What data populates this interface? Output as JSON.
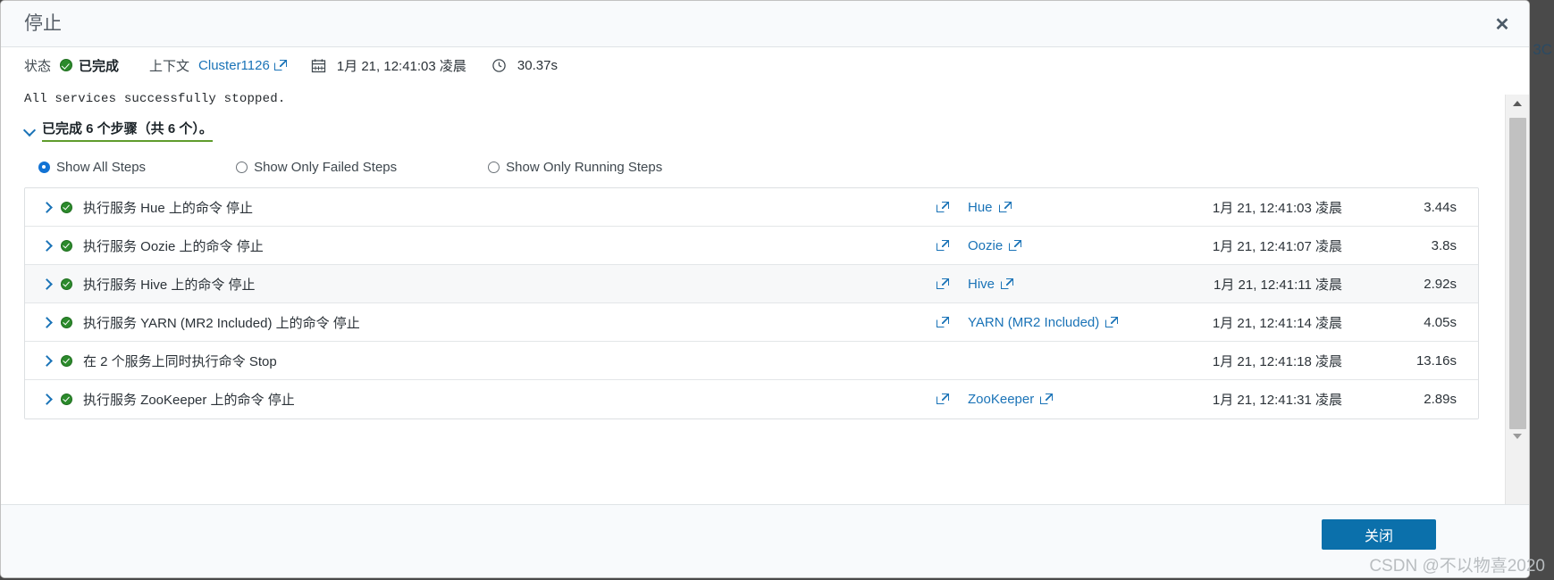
{
  "background": {
    "edge_text": "3C"
  },
  "modal": {
    "title": "停止",
    "close_x_icon": "close-icon",
    "status": {
      "status_label": "状态",
      "status_value": "已完成",
      "status_icon": "check-circle-icon",
      "context_label": "上下文",
      "context_link": "Cluster1126",
      "context_link_icon": "external-link-icon",
      "calendar_icon": "calendar-icon",
      "timestamp": "1月 21, 12:41:03 凌晨",
      "clock_icon": "clock-icon",
      "duration": "30.37s"
    },
    "log_message": "All services successfully stopped.",
    "steps_summary": {
      "chevron_icon": "chevron-down-icon",
      "text": "已完成 6 个步骤（共 6 个）。"
    },
    "filters": [
      {
        "label": "Show All Steps",
        "selected": true
      },
      {
        "label": "Show Only Failed Steps",
        "selected": false
      },
      {
        "label": "Show Only Running Steps",
        "selected": false
      }
    ],
    "steps": [
      {
        "name": "执行服务 Hue 上的命令 停止",
        "service": "Hue",
        "timestamp": "1月 21, 12:41:03 凌晨",
        "duration": "3.44s",
        "highlighted": false
      },
      {
        "name": "执行服务 Oozie 上的命令 停止",
        "service": "Oozie",
        "timestamp": "1月 21, 12:41:07 凌晨",
        "duration": "3.8s",
        "highlighted": false
      },
      {
        "name": "执行服务 Hive 上的命令 停止",
        "service": "Hive",
        "timestamp": "1月 21, 12:41:11 凌晨",
        "duration": "2.92s",
        "highlighted": true
      },
      {
        "name": "执行服务 YARN (MR2 Included) 上的命令 停止",
        "service": "YARN (MR2 Included)",
        "timestamp": "1月 21, 12:41:14 凌晨",
        "duration": "4.05s",
        "highlighted": false
      },
      {
        "name": "在 2 个服务上同时执行命令 Stop",
        "service": "",
        "timestamp": "1月 21, 12:41:18 凌晨",
        "duration": "13.16s",
        "highlighted": false
      },
      {
        "name": "执行服务 ZooKeeper 上的命令 停止",
        "service": "ZooKeeper",
        "timestamp": "1月 21, 12:41:31 凌晨",
        "duration": "2.89s",
        "highlighted": false
      }
    ],
    "footer": {
      "close_button": "关闭"
    }
  },
  "watermark": "CSDN @不以物喜2020",
  "colors": {
    "accent_blue": "#1a73b7",
    "button_blue": "#0b70ab",
    "success_green": "#2c8a2c",
    "underline_green": "#5f9c2c",
    "radio_blue": "#1273d4",
    "header_bg": "#f8fafc",
    "row_alt_bg": "#f7f8f9"
  }
}
